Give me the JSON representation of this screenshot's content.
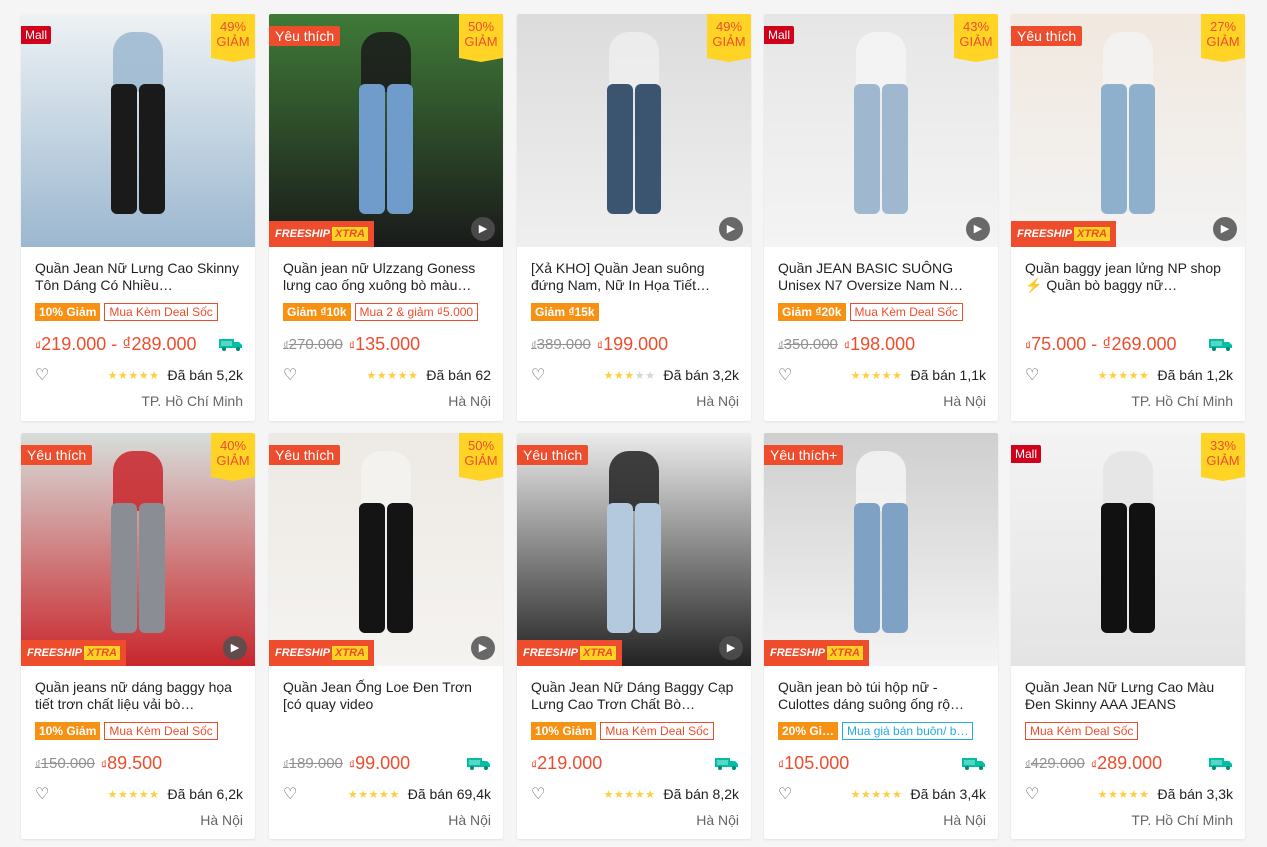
{
  "products": [
    {
      "name": "Quần Jean Nữ Lưng Cao Skinny Tôn Dáng Có Nhiều…",
      "badge": "Mall",
      "discount_pct": "49%",
      "discount_word": "GIẢM",
      "freeship": false,
      "video": false,
      "tag_off": "10% Giảm",
      "tag_deal": "Mua Kèm Deal Sốc",
      "old_price": "",
      "price": "219.000 - ₫289.000",
      "free_ship_icon": true,
      "rating": 5,
      "sold": "Đã bán 5,2k",
      "location": "TP. Hồ Chí Minh",
      "palette": [
        "#eef2f4",
        "#1a1a1a",
        "#9bb7d0"
      ]
    },
    {
      "name": "Quần jean nữ Ulzzang Goness lưng cao ống xuông bò màu…",
      "badge": "Yêu thích",
      "discount_pct": "50%",
      "discount_word": "GIẢM",
      "freeship": true,
      "video": true,
      "tag_off": "Giảm ₫10k",
      "tag_deal": "Mua 2 & giảm ₫5.000",
      "old_price": "270.000",
      "price": "135.000",
      "free_ship_icon": false,
      "rating": 5,
      "sold": "Đã bán 62",
      "location": "Hà Nội",
      "palette": [
        "#3f7a38",
        "#6f9ccb",
        "#1a1a1a"
      ]
    },
    {
      "name": "[Xả KHO] Quần Jean suông đứng Nam, Nữ In Họa Tiết…",
      "badge": "",
      "discount_pct": "49%",
      "discount_word": "GIẢM",
      "freeship": false,
      "video": true,
      "tag_off": "Giảm ₫15k",
      "tag_deal": "",
      "old_price": "389.000",
      "price": "199.000",
      "free_ship_icon": false,
      "rating": 3,
      "sold": "Đã bán 3,2k",
      "location": "Hà Nội",
      "palette": [
        "#dcdcdc",
        "#3b5470",
        "#efefef"
      ]
    },
    {
      "name": "Quần JEAN BASIC SUÔNG Unisex N7 Oversize Nam N…",
      "badge": "Mall",
      "discount_pct": "43%",
      "discount_word": "GIẢM",
      "freeship": false,
      "video": true,
      "tag_off": "Giảm ₫20k",
      "tag_deal": "Mua Kèm Deal Sốc",
      "old_price": "350.000",
      "price": "198.000",
      "free_ship_icon": false,
      "rating": 5,
      "sold": "Đã bán 1,1k",
      "location": "Hà Nội",
      "palette": [
        "#e6e6e6",
        "#9fb8cf",
        "#f4f4f4"
      ]
    },
    {
      "name": "Quần baggy jean lửng NP shop ⚡ Quần bò baggy nữ…",
      "badge": "Yêu thích",
      "discount_pct": "27%",
      "discount_word": "GIẢM",
      "freeship": true,
      "video": true,
      "tag_off": "",
      "tag_deal": "",
      "old_price": "",
      "price": "75.000 - ₫269.000",
      "free_ship_icon": true,
      "rating": 5,
      "sold": "Đã bán 1,2k",
      "location": "TP. Hồ Chí Minh",
      "palette": [
        "#f1e8df",
        "#8fb0cc",
        "#f3f3f3"
      ]
    },
    {
      "name": "Quần jeans nữ dáng baggy họa tiết trơn chất liệu vải bò…",
      "badge": "Yêu thích",
      "discount_pct": "40%",
      "discount_word": "GIẢM",
      "freeship": true,
      "video": true,
      "tag_off": "10% Giảm",
      "tag_deal": "Mua Kèm Deal Sốc",
      "old_price": "150.000",
      "price": "89.500",
      "free_ship_icon": false,
      "rating": 5,
      "sold": "Đã bán 6,2k",
      "location": "Hà Nội",
      "palette": [
        "#d7dedb",
        "#8a8d93",
        "#c8262c"
      ]
    },
    {
      "name": "Quần Jean Ống Loe Đen Trơn [có quay video",
      "badge": "Yêu thích",
      "discount_pct": "50%",
      "discount_word": "GIẢM",
      "freeship": true,
      "video": true,
      "tag_off": "",
      "tag_deal": "",
      "old_price": "189.000",
      "price": "99.000",
      "free_ship_icon": true,
      "rating": 5,
      "sold": "Đã bán 69,4k",
      "location": "Hà Nội",
      "palette": [
        "#ede9e4",
        "#141414",
        "#f5f3f0"
      ]
    },
    {
      "name": "Quần Jean Nữ Dáng Baggy Cạp Lưng Cao Trơn Chất Bò…",
      "badge": "Yêu thích",
      "discount_pct": "",
      "discount_word": "",
      "freeship": true,
      "video": true,
      "tag_off": "10% Giảm",
      "tag_deal": "Mua Kèm Deal Sốc",
      "old_price": "",
      "price": "219.000",
      "free_ship_icon": true,
      "rating": 5,
      "sold": "Đã bán 8,2k",
      "location": "Hà Nội",
      "palette": [
        "#ececec",
        "#b4c8de",
        "#222"
      ]
    },
    {
      "name": "Quần jean bò túi hộp nữ - Culottes dáng suông ống rộ…",
      "badge": "Yêu thích+",
      "discount_pct": "",
      "discount_word": "",
      "freeship": true,
      "video": false,
      "tag_off": "20% Gi…",
      "tag_deal": "",
      "tag_blue": "Mua giá bán buôn/ b…",
      "old_price": "",
      "price": "105.000",
      "free_ship_icon": true,
      "rating": 5,
      "sold": "Đã bán 3,4k",
      "location": "Hà Nội",
      "palette": [
        "#cfcfcf",
        "#7ea1c4",
        "#f4f4f4"
      ]
    },
    {
      "name": "Quần Jean Nữ Lưng Cao Màu Đen Skinny AAA JEANS",
      "badge": "Mall",
      "discount_pct": "33%",
      "discount_word": "GIẢM",
      "freeship": false,
      "video": false,
      "tag_off": "",
      "tag_deal": "Mua Kèm Deal Sốc",
      "old_price": "429.000",
      "price": "289.000",
      "free_ship_icon": true,
      "rating": 5,
      "sold": "Đã bán 3,3k",
      "location": "TP. Hồ Chí Minh",
      "palette": [
        "#f3f3f3",
        "#111111",
        "#e4e4e4"
      ]
    }
  ],
  "freeship_text": "FREESHIP",
  "xtra_text": "XTRA",
  "currency": "₫",
  "heart_icon": "heart-outline-icon",
  "colors": {
    "accent": "#ee4d2d",
    "mall": "#d0011b",
    "discount_bg": "#ffd424",
    "star": "#ffce3d",
    "tag_orange": "#f69113"
  }
}
